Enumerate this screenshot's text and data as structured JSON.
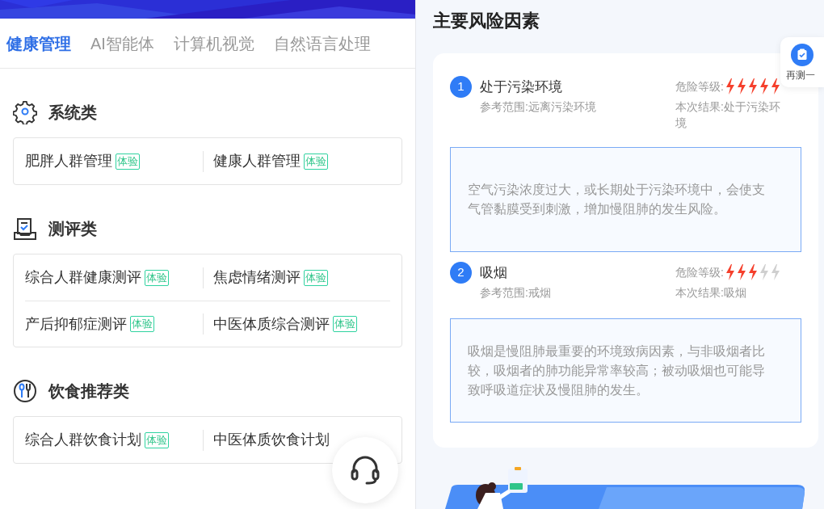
{
  "tabs": [
    {
      "label": "健康管理",
      "selected": true
    },
    {
      "label": "AI智能体",
      "selected": false
    },
    {
      "label": "计算机视觉",
      "selected": false
    },
    {
      "label": "自然语言处理",
      "selected": false
    }
  ],
  "sections": [
    {
      "kind": "system",
      "title": "系统类",
      "rows": [
        [
          {
            "label": "肥胖人群管理",
            "badge": "体验"
          },
          {
            "label": "健康人群管理",
            "badge": "体验"
          }
        ]
      ]
    },
    {
      "kind": "assess",
      "title": "测评类",
      "rows": [
        [
          {
            "label": "综合人群健康测评",
            "badge": "体验"
          },
          {
            "label": "焦虑情绪测评",
            "badge": "体验"
          }
        ],
        [
          {
            "label": "产后抑郁症测评",
            "badge": "体验"
          },
          {
            "label": "中医体质综合测评",
            "badge": "体验"
          }
        ]
      ]
    },
    {
      "kind": "diet",
      "title": "饮食推荐类",
      "rows": [
        [
          {
            "label": "综合人群饮食计划",
            "badge": "体验"
          },
          {
            "label": "中医体质饮食计划"
          }
        ]
      ]
    }
  ],
  "risk_panel": {
    "title": "主要风险因素",
    "factors": [
      {
        "number": "1",
        "name": "处于污染环境",
        "reference": "参考范围:远离污染环境",
        "level_label": "危险等级:",
        "stars": 5,
        "result": "本次结果:处于污染环境",
        "description": "空气污染浓度过大，或长期处于污染环境中，会使支气管黏膜受到刺激，增加慢阻肺的发生风险。"
      },
      {
        "number": "2",
        "name": "吸烟",
        "reference": "参考范围:戒烟",
        "level_label": "危险等级:",
        "stars": 3,
        "result": "本次结果:吸烟",
        "description": "吸烟是慢阻肺最重要的环境致病因素，与非吸烟者比较，吸烟者的肺功能异常率较高；被动吸烟也可能导致呼吸道症状及慢阻肺的发生。"
      }
    ]
  },
  "retest_button": {
    "label": "再测一"
  }
}
